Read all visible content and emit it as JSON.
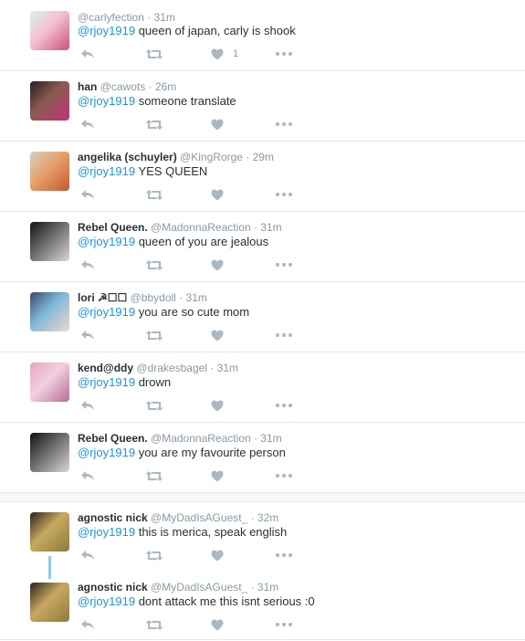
{
  "tweets": [
    {
      "name": "",
      "handle": "@carlyfection",
      "time": "31m",
      "mention": "@rjoy1919",
      "text": "queen of japan, carly is shook",
      "likes": "1",
      "avatar_colors": [
        "#d9f1f0",
        "#c9527a",
        "#f4c0d0"
      ]
    },
    {
      "name": "han",
      "handle": "@cawots",
      "time": "26m",
      "mention": "@rjoy1919",
      "text": "someone translate",
      "likes": "",
      "avatar_colors": [
        "#2a1c22",
        "#c1327a",
        "#8a5c50"
      ]
    },
    {
      "name": "angelika (schuyler)",
      "handle": "@KingRorge",
      "time": "29m",
      "mention": "@rjoy1919",
      "text": "YES QUEEN",
      "likes": "",
      "avatar_colors": [
        "#d8d0c6",
        "#c35a2e",
        "#e6a06a"
      ]
    },
    {
      "name": "Rebel Queen.",
      "handle": "@MadonnaReaction",
      "time": "31m",
      "mention": "@rjoy1919",
      "text": "queen of you are jealous",
      "likes": "",
      "avatar_colors": [
        "#111111",
        "#d8d8d8",
        "#6a6a6a"
      ]
    },
    {
      "name": "lori ☭☐☐",
      "handle": "@bbydoll",
      "time": "31m",
      "mention": "@rjoy1919",
      "text": "you are so cute mom",
      "likes": "",
      "avatar_colors": [
        "#3b4a6b",
        "#f0d8c8",
        "#7fb8d8"
      ]
    },
    {
      "name": "kend@ddy",
      "handle": "@drakesbagel",
      "time": "31m",
      "mention": "@rjoy1919",
      "text": "drown",
      "likes": "",
      "avatar_colors": [
        "#e3a6c0",
        "#b46e95",
        "#f4d0de"
      ]
    },
    {
      "name": "Rebel Queen.",
      "handle": "@MadonnaReaction",
      "time": "31m",
      "mention": "@rjoy1919",
      "text": "you are my favourite person",
      "likes": "",
      "avatar_colors": [
        "#111111",
        "#d8d8d8",
        "#6a6a6a"
      ]
    },
    {
      "name": "agnostic nick",
      "handle": "@MyDadIsAGuest_",
      "time": "32m",
      "mention": "@rjoy1919",
      "text": "this is merica, speak english",
      "likes": "",
      "avatar_colors": [
        "#2a2418",
        "#8c7a3c",
        "#c8a860"
      ]
    },
    {
      "name": "agnostic nick",
      "handle": "@MyDadIsAGuest_",
      "time": "31m",
      "mention": "@rjoy1919",
      "text": "dont attack me this isnt serious :0",
      "likes": "",
      "avatar_colors": [
        "#2a2418",
        "#8c7a3c",
        "#c8a860"
      ]
    }
  ],
  "separator": " · ",
  "icons": {
    "reply": "reply-icon",
    "retweet": "retweet-icon",
    "like": "heart-icon",
    "more": "more-icon"
  },
  "colors": {
    "link": "#1b95e0",
    "muted": "#8899a6",
    "icon": "#aab8c2",
    "thread": "#8ec9ec"
  }
}
